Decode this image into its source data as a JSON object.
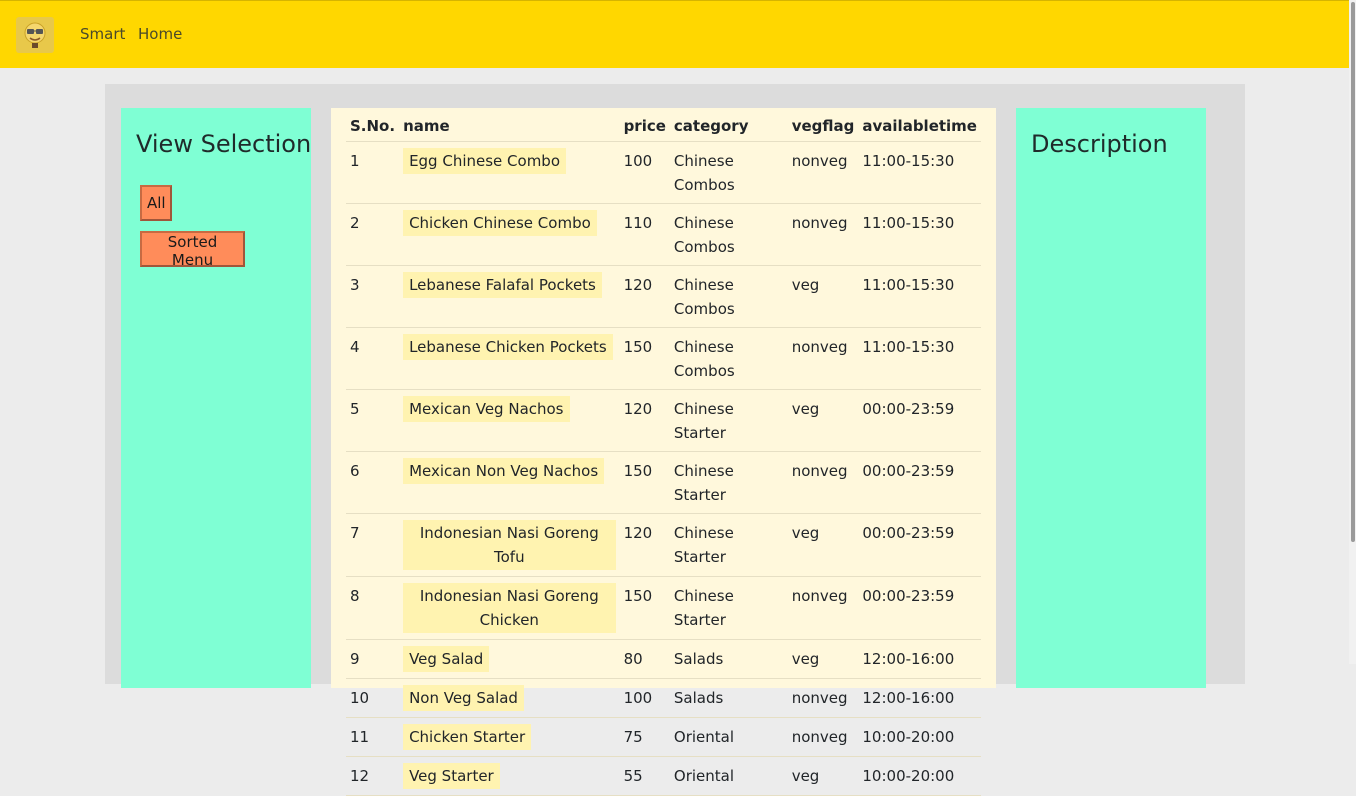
{
  "nav": {
    "brand": "Smart",
    "home": "Home"
  },
  "left_panel": {
    "title": "View Selection",
    "buttons": {
      "all": "All",
      "sorted": "Sorted Menu"
    }
  },
  "right_panel": {
    "title": "Description"
  },
  "table": {
    "headers": [
      "S.No.",
      "name",
      "price",
      "category",
      "vegflag",
      "availabletime"
    ],
    "rows": [
      {
        "sno": "1",
        "name": "Egg Chinese Combo",
        "price": "100",
        "category": "Chinese Combos",
        "vegflag": "nonveg",
        "time": "11:00-15:30"
      },
      {
        "sno": "2",
        "name": "Chicken Chinese Combo",
        "price": "110",
        "category": "Chinese Combos",
        "vegflag": "nonveg",
        "time": "11:00-15:30"
      },
      {
        "sno": "3",
        "name": "Lebanese Falafal Pockets",
        "price": "120",
        "category": "Chinese Combos",
        "vegflag": "veg",
        "time": "11:00-15:30"
      },
      {
        "sno": "4",
        "name": "Lebanese Chicken Pockets",
        "price": "150",
        "category": "Chinese Combos",
        "vegflag": "nonveg",
        "time": "11:00-15:30"
      },
      {
        "sno": "5",
        "name": "Mexican Veg Nachos",
        "price": "120",
        "category": "Chinese Starter",
        "vegflag": "veg",
        "time": "00:00-23:59"
      },
      {
        "sno": "6",
        "name": "Mexican Non Veg Nachos",
        "price": "150",
        "category": "Chinese Starter",
        "vegflag": "nonveg",
        "time": "00:00-23:59"
      },
      {
        "sno": "7",
        "name": "Indonesian Nasi Goreng Tofu",
        "price": "120",
        "category": "Chinese Starter",
        "vegflag": "veg",
        "time": "00:00-23:59"
      },
      {
        "sno": "8",
        "name": "Indonesian Nasi Goreng Chicken",
        "price": "150",
        "category": "Chinese Starter",
        "vegflag": "nonveg",
        "time": "00:00-23:59"
      },
      {
        "sno": "9",
        "name": "Veg Salad",
        "price": "80",
        "category": "Salads",
        "vegflag": "veg",
        "time": "12:00-16:00"
      },
      {
        "sno": "10",
        "name": "Non Veg Salad",
        "price": "100",
        "category": "Salads",
        "vegflag": "nonveg",
        "time": "12:00-16:00"
      },
      {
        "sno": "11",
        "name": "Chicken Starter",
        "price": "75",
        "category": "Oriental",
        "vegflag": "nonveg",
        "time": "10:00-20:00"
      },
      {
        "sno": "12",
        "name": "Veg Starter",
        "price": "55",
        "category": "Oriental",
        "vegflag": "veg",
        "time": "10:00-20:00"
      }
    ]
  },
  "colors": {
    "navbar": "#ffd700",
    "panel": "#7fffd4",
    "table_bg": "#fff8dc",
    "button": "#ff8c5a"
  }
}
